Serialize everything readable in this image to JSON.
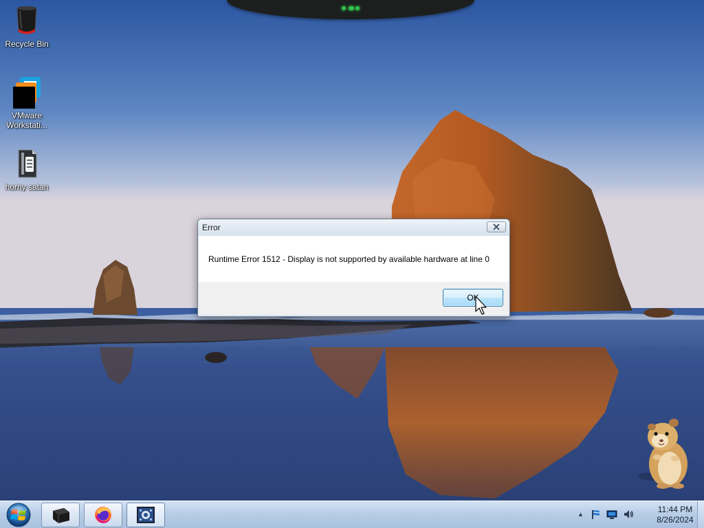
{
  "desktop": {
    "icons": [
      {
        "label": "Recycle Bin",
        "icon": "recycle-bin-icon"
      },
      {
        "label": "VMware\nWorkstati...",
        "line1": "VMware",
        "line2": "Workstati...",
        "icon": "vmware-icon"
      },
      {
        "label": "horny satan",
        "icon": "archive-file-icon"
      }
    ]
  },
  "dialog": {
    "title": "Error",
    "message": "Runtime Error 1512 - Display is not supported by available hardware at line 0",
    "ok_label": "OK",
    "close_icon": "close-icon"
  },
  "taskbar": {
    "start_icon": "windows-start-orb-icon",
    "pinned": [
      {
        "name": "terminal",
        "icon": "terminal-icon"
      },
      {
        "name": "firefox",
        "icon": "firefox-icon"
      },
      {
        "name": "tool",
        "icon": "app-tool-icon"
      }
    ],
    "tray": {
      "chevron": "▲",
      "icons": [
        "action-center-flag-icon",
        "network-icon",
        "volume-icon"
      ],
      "time": "11:44 PM",
      "date": "8/26/2024"
    }
  },
  "colors": {
    "sky_top": "#2e5aa6",
    "sky_bottom": "#c9cee0",
    "rock": "#b5531f",
    "taskbar": "#b8cde6",
    "led": "#31c24a"
  }
}
